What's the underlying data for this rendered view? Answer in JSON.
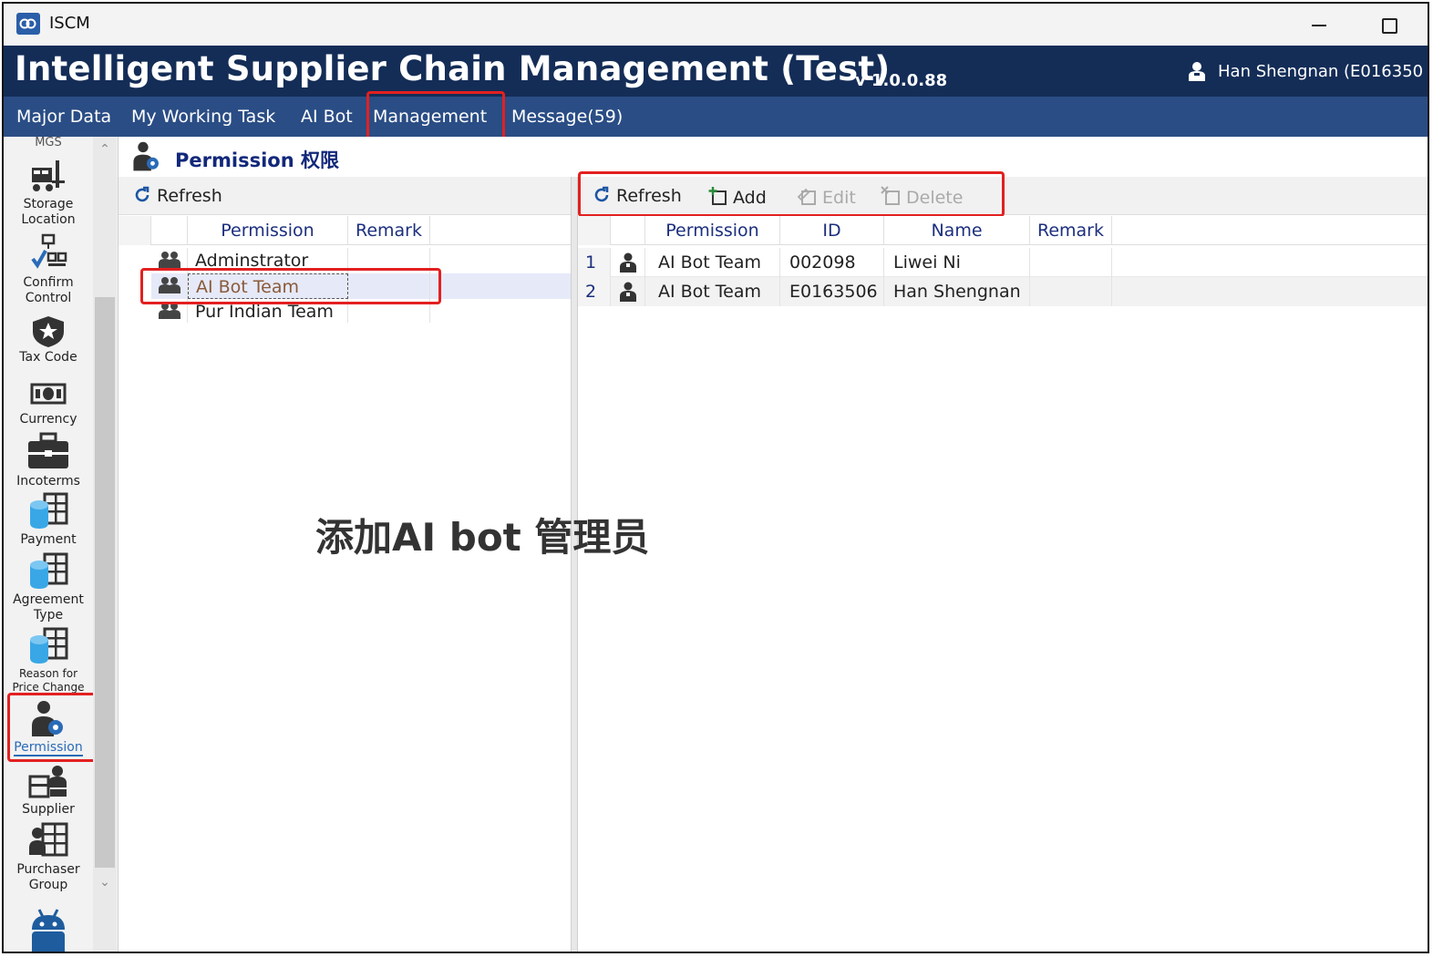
{
  "window": {
    "app_name": "ISCM"
  },
  "header": {
    "title": "Intelligent Supplier Chain Management (Test)",
    "version": "v 1.0.0.88",
    "user": "Han Shengnan (E016350"
  },
  "menu": {
    "items": [
      {
        "label": "Major Data"
      },
      {
        "label": "My Working Task"
      },
      {
        "label": "AI Bot"
      },
      {
        "label": "Management",
        "highlighted": true
      },
      {
        "label": "Message(59)"
      }
    ]
  },
  "sidebar": {
    "partial_top": "MGS",
    "items": [
      {
        "label1": "Storage",
        "label2": "Location",
        "icon": "forklift-icon"
      },
      {
        "label1": "Confirm",
        "label2": "Control",
        "icon": "confirm-control-icon"
      },
      {
        "label1": "Tax Code",
        "label2": "",
        "icon": "shield-star-icon"
      },
      {
        "label1": "Currency",
        "label2": "",
        "icon": "banknote-icon"
      },
      {
        "label1": "Incoterms",
        "label2": "",
        "icon": "briefcase-icon"
      },
      {
        "label1": "Payment",
        "label2": "",
        "icon": "database-table-icon"
      },
      {
        "label1": "Agreement",
        "label2": "Type",
        "icon": "database-table-icon"
      },
      {
        "label1": "Reason for",
        "label2": "Price Change",
        "icon": "database-table-icon"
      },
      {
        "label1": "Permission",
        "label2": "",
        "icon": "user-gear-icon",
        "selected": true
      },
      {
        "label1": "Supplier",
        "label2": "",
        "icon": "supplier-icon"
      },
      {
        "label1": "Purchaser",
        "label2": "Group",
        "icon": "purchaser-group-icon"
      }
    ]
  },
  "page": {
    "title": "Permission 权限"
  },
  "left_pane": {
    "toolbar": {
      "refresh": "Refresh"
    },
    "columns": [
      "Permission",
      "Remark"
    ],
    "rows": [
      {
        "permission": "Adminstrator",
        "remark": ""
      },
      {
        "permission": "AI Bot Team",
        "remark": "",
        "selected": true
      },
      {
        "permission": "Pur Indian Team",
        "remark": ""
      }
    ]
  },
  "right_pane": {
    "toolbar": {
      "refresh": "Refresh",
      "add": "Add",
      "edit": "Edit",
      "delete": "Delete"
    },
    "columns": [
      "Permission",
      "ID",
      "Name",
      "Remark"
    ],
    "rows": [
      {
        "index": "1",
        "permission": "AI Bot Team",
        "id": "002098",
        "name": "Liwei Ni",
        "remark": ""
      },
      {
        "index": "2",
        "permission": "AI Bot Team",
        "id": "E0163506",
        "name": "Han Shengnan",
        "remark": ""
      }
    ]
  },
  "annotation": {
    "text": "添加AI bot 管理员"
  },
  "colors": {
    "header_bg": "#142d57",
    "menu_bg": "#2a4d85",
    "highlight": "#e32020",
    "column_header_text": "#1c2f7e",
    "selected_row": "#e6e9f8",
    "selected_text": "#8a5a3a"
  }
}
